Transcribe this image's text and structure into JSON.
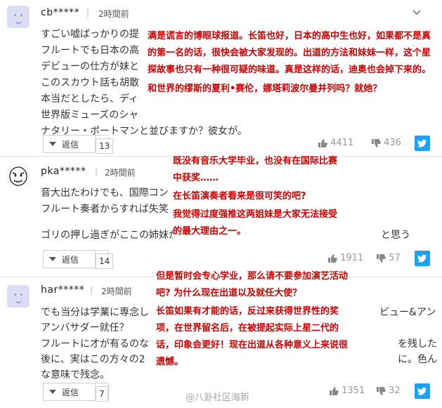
{
  "comments": [
    {
      "user": "cb*****",
      "sep": "|",
      "time": "2時間前",
      "lines": [
        "すごい嘘ばっかりの提",
        "フルートでも日本の高",
        "デビューの仕方が妹と",
        "このスカウト話も胡散",
        "本当だとしたら、ディ",
        "世界版ミューズのシャ",
        "ナタリー・ポートマンと並びますか？彼女が。"
      ],
      "reply_label": "返信",
      "reply_count": "13",
      "upvotes": "4411",
      "downvotes": "436",
      "overlay_lines": [
        "满是谎言的博眼球报道。长笛也好，日本的高中生也好，如果都不是真",
        "的第一名的话，很快会被大家发现的。出道的方法和妹妹一样，这个星",
        "探故事也只有一种很可疑的味道。真是这样的话，迪奥也会掉下来的。",
        "和世界的缪斯的夏利•赛伦，娜塔莉波尔曼并列吗？就她？"
      ]
    },
    {
      "user": "pka*****",
      "sep": "|",
      "time": "2時間前",
      "lines": [
        "音大出たわけでも、国際コン",
        "フルート奏者からすれば失笑",
        "ゴリの押し過ぎがここの姉妹が",
        "と思う"
      ],
      "reply_label": "返信",
      "reply_count": "14",
      "upvotes": "1911",
      "downvotes": "57",
      "overlay_lines": [
        "既没有音乐大学毕业，也没有在国际比赛",
        "中获奖……",
        "在长笛演奏者看来是很可笑的吧?",
        "我觉得过度强推这两姐妹是大家无法接受",
        "的最大理由之一。"
      ]
    },
    {
      "user": "har*****",
      "sep": "|",
      "time": "2時間前",
      "lines": [
        "でも当分は学業に専念し",
        "アンバサダー就任？",
        "フルートに才が有るのな",
        "後に、実はこの方々の2",
        "な意味で残念。"
      ],
      "right_fragments": [
        "ビュー&アン",
        "を残した",
        "に。色ん"
      ],
      "reply_label": "返信",
      "reply_count": "7",
      "upvotes": "1351",
      "downvotes": "32",
      "overlay_lines": [
        "但是暂时会专心学业，那么请不要参加演艺活动",
        "吧? 为什么现在出道以及就任大使？",
        "长笛如果有才能的话，反过来获得世界性的奖",
        "项，在世界留名后，在被提起实际上星二代的",
        "话，印象会更好！现在出道从各种意义上来说很",
        "遗憾。"
      ]
    }
  ],
  "watermark": "@八卦社区海新",
  "colors": {
    "overlay_red": "#cc0000",
    "twitter": "#1da1f2"
  }
}
